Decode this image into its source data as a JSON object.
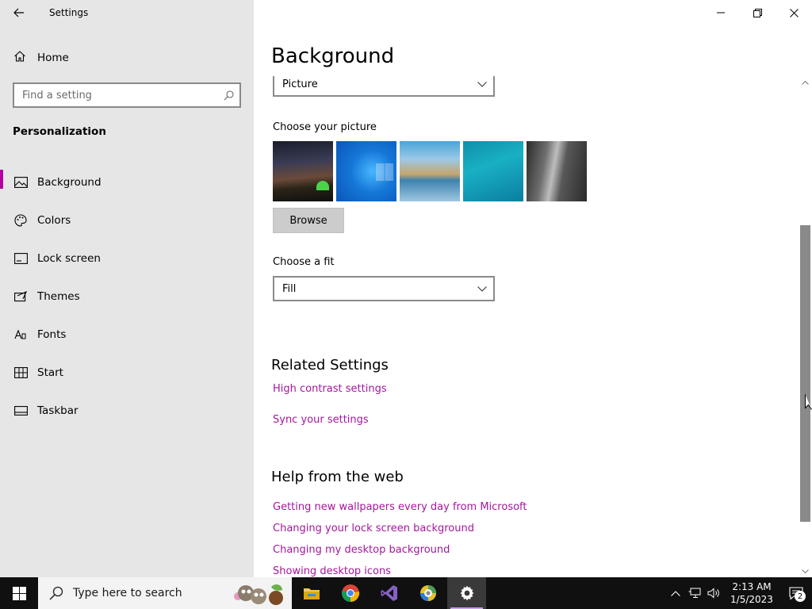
{
  "window": {
    "title": "Settings"
  },
  "sidebar": {
    "home_label": "Home",
    "search_placeholder": "Find a setting",
    "section_title": "Personalization",
    "items": [
      {
        "label": "Background",
        "icon": "image-icon",
        "active": true
      },
      {
        "label": "Colors",
        "icon": "palette-icon"
      },
      {
        "label": "Lock screen",
        "icon": "lock-screen-icon"
      },
      {
        "label": "Themes",
        "icon": "themes-icon"
      },
      {
        "label": "Fonts",
        "icon": "fonts-icon"
      },
      {
        "label": "Start",
        "icon": "start-icon"
      },
      {
        "label": "Taskbar",
        "icon": "taskbar-icon"
      }
    ]
  },
  "main": {
    "page_title": "Background",
    "background_dropdown_value": "Picture",
    "choose_picture_label": "Choose your picture",
    "browse_label": "Browse",
    "choose_fit_label": "Choose a fit",
    "fit_dropdown_value": "Fill",
    "related_settings": {
      "title": "Related Settings",
      "links": [
        "High contrast settings",
        "Sync your settings"
      ]
    },
    "help": {
      "title": "Help from the web",
      "links": [
        "Getting new wallpapers every day from Microsoft",
        "Changing your lock screen background",
        "Changing my desktop background",
        "Showing desktop icons"
      ]
    }
  },
  "taskbar": {
    "search_text": "Type here to search",
    "apps": [
      "file-explorer-icon",
      "chrome-icon",
      "visual-studio-icon",
      "image-viewer-icon",
      "settings-gear-icon"
    ],
    "clock_time": "2:13 AM",
    "clock_date": "1/5/2023",
    "notification_count": "2"
  },
  "colors": {
    "accent": "#b4009e",
    "link": "#a4179c",
    "sidebar_bg": "#e6e6e6",
    "taskbar_bg": "#101010"
  }
}
